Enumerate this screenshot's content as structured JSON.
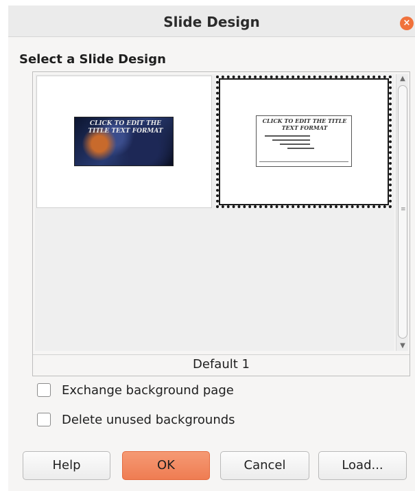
{
  "window": {
    "title": "Slide Design",
    "close_symbol": "×"
  },
  "heading": "Select a Slide Design",
  "gallery": {
    "designs": [
      {
        "preview_text": "CLICK TO EDIT THE TITLE TEXT FORMAT",
        "style": "dark"
      },
      {
        "preview_text": "CLICK TO EDIT THE TITLE TEXT FORMAT",
        "style": "light"
      }
    ],
    "selected_design_name": "Default 1",
    "scroll": {
      "up_arrow": "▲",
      "down_arrow": "▼",
      "grip": "≡"
    }
  },
  "options": {
    "exchange_background": {
      "label": "Exchange background page",
      "checked": false
    },
    "delete_unused": {
      "label": "Delete unused backgrounds",
      "checked": false
    }
  },
  "buttons": {
    "help": "Help",
    "ok": "OK",
    "cancel": "Cancel",
    "load": "Load..."
  },
  "colors": {
    "accent": "#ef7c52",
    "close": "#f0723c"
  }
}
